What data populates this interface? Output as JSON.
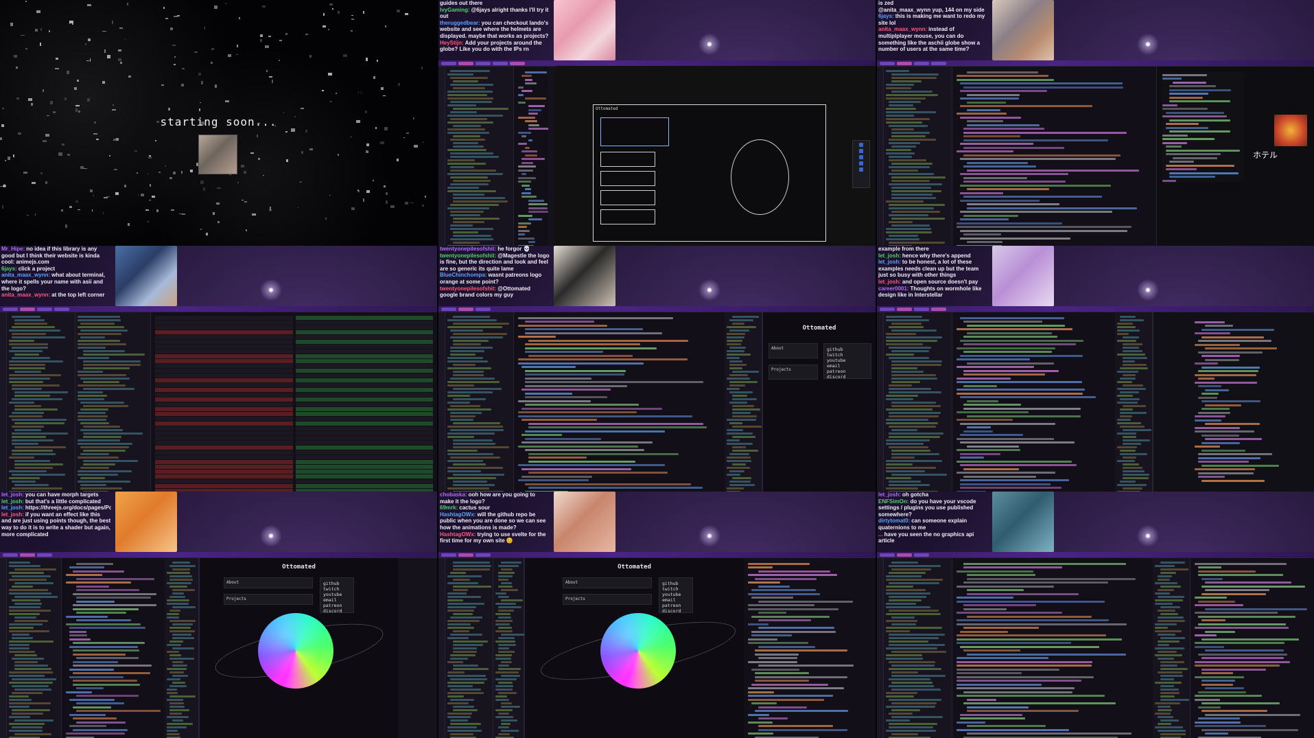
{
  "cells": {
    "starting": {
      "text": "starting soon..."
    },
    "c2": {
      "chat": [
        {
          "user": "",
          "msg": "guides out there"
        },
        {
          "user": "IvyGaming:",
          "msg": "@6jays alright thanks I'll try it out"
        },
        {
          "user": "theruggedbear:",
          "msg": "you can checkout lando's website and see where the helmets are displayed. maybe that works as projects?"
        },
        {
          "user": "HeyStijn:",
          "msg": "Add your projects around the globe? Like you do with the IPs rn"
        }
      ],
      "canvas_label": "Ottomated"
    },
    "c3": {
      "chat": [
        {
          "user": "",
          "msg": "is zed"
        },
        {
          "user": "",
          "msg": "@anita_maax_wynn yup, 144 on my side"
        },
        {
          "user": "6jays:",
          "msg": "this is making me want to redo my site lol"
        },
        {
          "user": "anita_maax_wynn:",
          "msg": "instead of multiplplayer mouse, you can do something like the aschii globe show a number of users at the same time?"
        }
      ],
      "kana": "ホテル"
    },
    "c4": {
      "chat": [
        {
          "user": "Mr_Hipe:",
          "msg": "no idea if this library is any good but I think their website is kinda cool: animejs.com"
        },
        {
          "user": "6jays:",
          "msg": "click a project"
        },
        {
          "user": "anita_maax_wynn:",
          "msg": "what about terminal, where it spells your name with asii and the logo?"
        },
        {
          "user": "anita_maax_wynn:",
          "msg": "at the top left corner"
        }
      ]
    },
    "c5": {
      "chat": [
        {
          "user": "twentyonepilesofshit:",
          "msg": "he forgor 💀"
        },
        {
          "user": "twentyonepilesofshit:",
          "msg": "@Magestle the logo is fine, but the direction and look and feel are so generic its quite lame"
        },
        {
          "user": "BlueChinchompa:",
          "msg": "wasnt patreons logo orange at some point?"
        },
        {
          "user": "twentyonepilesofshit:",
          "msg": "@Ottomated google brand colors my guy"
        }
      ],
      "site": {
        "title": "Ottomated",
        "about": "About",
        "projects": "Projects",
        "links": [
          "github",
          "twitch",
          "youtube",
          "email",
          "patreon",
          "discord"
        ]
      }
    },
    "c6": {
      "chat": [
        {
          "user": "",
          "msg": "example from there"
        },
        {
          "user": "let_josh:",
          "msg": "hence why there's append"
        },
        {
          "user": "let_josh:",
          "msg": "to be honest, a lot of these examples needs clean up but the team just so busy with other things"
        },
        {
          "user": "let_josh:",
          "msg": "and open source doesn't pay"
        },
        {
          "user": "career0001:",
          "msg": "Thoughts on wormhole like design like in Interstellar"
        }
      ]
    },
    "c7": {
      "chat": [
        {
          "user": "let_josh:",
          "msg": "you can have morph targets"
        },
        {
          "user": "let_josh:",
          "msg": "but that's a little complicated"
        },
        {
          "user": "let_josh:",
          "msg": "https://threejs.org/docs/pages/Points.html#updateMorphTargets"
        },
        {
          "user": "let_josh:",
          "msg": "if you want an effect like this and are just using points though, the best way to do it is to write a shader but again, more complicated"
        }
      ],
      "site": {
        "title": "Ottomated",
        "about": "About",
        "projects": "Projects",
        "links": [
          "github",
          "twitch",
          "youtube",
          "email",
          "patreon",
          "discord"
        ]
      }
    },
    "c8": {
      "chat": [
        {
          "user": "chobaska:",
          "msg": "ooh how are you going to make it the logo?"
        },
        {
          "user": "69mrk:",
          "msg": "cactus sour"
        },
        {
          "user": "HashtagOWx:",
          "msg": "will the github repo be public when you are done so we can see how the animations is made?"
        },
        {
          "user": "HashtagOWx:",
          "msg": "trying to use svelte for the first time for my own site 😊"
        }
      ],
      "site": {
        "title": "Ottomated",
        "about": "About",
        "projects": "Projects",
        "links": [
          "github",
          "twitch",
          "youtube",
          "email",
          "patreon",
          "discord"
        ]
      }
    },
    "c9": {
      "chat": [
        {
          "user": "let_josh:",
          "msg": "oh gotcha"
        },
        {
          "user": "ENFSimOn:",
          "msg": "do you have your vscode settings / plugins you use published somewhere?"
        },
        {
          "user": "dirtytomat0:",
          "msg": "can someone explain quaternions to me"
        },
        {
          "user": "...",
          "msg": "have you seen the no graphics api article"
        }
      ]
    }
  },
  "colors": {
    "user_name": "#b46cff",
    "user_alt": "#4fd26a",
    "user_blue": "#5aa6ff",
    "user_red": "#ff5a7a"
  }
}
